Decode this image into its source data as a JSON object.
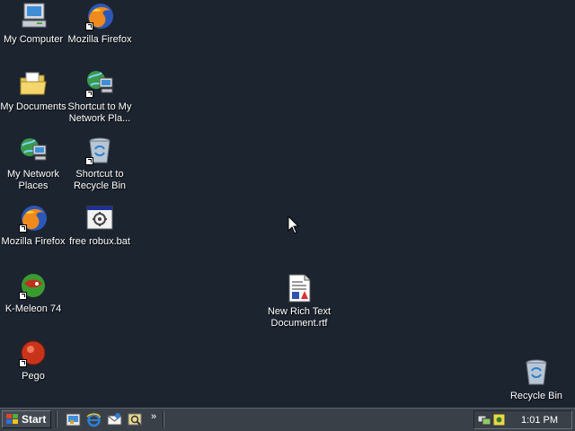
{
  "desktop": {
    "icons": [
      {
        "label": "My Computer"
      },
      {
        "label": "Mozilla Firefox"
      },
      {
        "label": "My Documents"
      },
      {
        "label": "Shortcut to My Network Pla..."
      },
      {
        "label": "My Network Places"
      },
      {
        "label": "Shortcut to Recycle Bin"
      },
      {
        "label": "Mozilla Firefox"
      },
      {
        "label": "free robux.bat"
      },
      {
        "label": "K-Meleon 74"
      },
      {
        "label": "New Rich Text Document.rtf"
      },
      {
        "label": "Pego"
      },
      {
        "label": "Recycle Bin"
      }
    ]
  },
  "taskbar": {
    "start_label": "Start",
    "quick_launch": [
      "show-desktop-icon",
      "internet-explorer-icon",
      "outlook-express-icon",
      "search-icon"
    ],
    "more_label": "»",
    "clock": "1:01 PM"
  },
  "colors": {
    "desktop": "#1c2430",
    "taskbar": "#3a4048"
  }
}
